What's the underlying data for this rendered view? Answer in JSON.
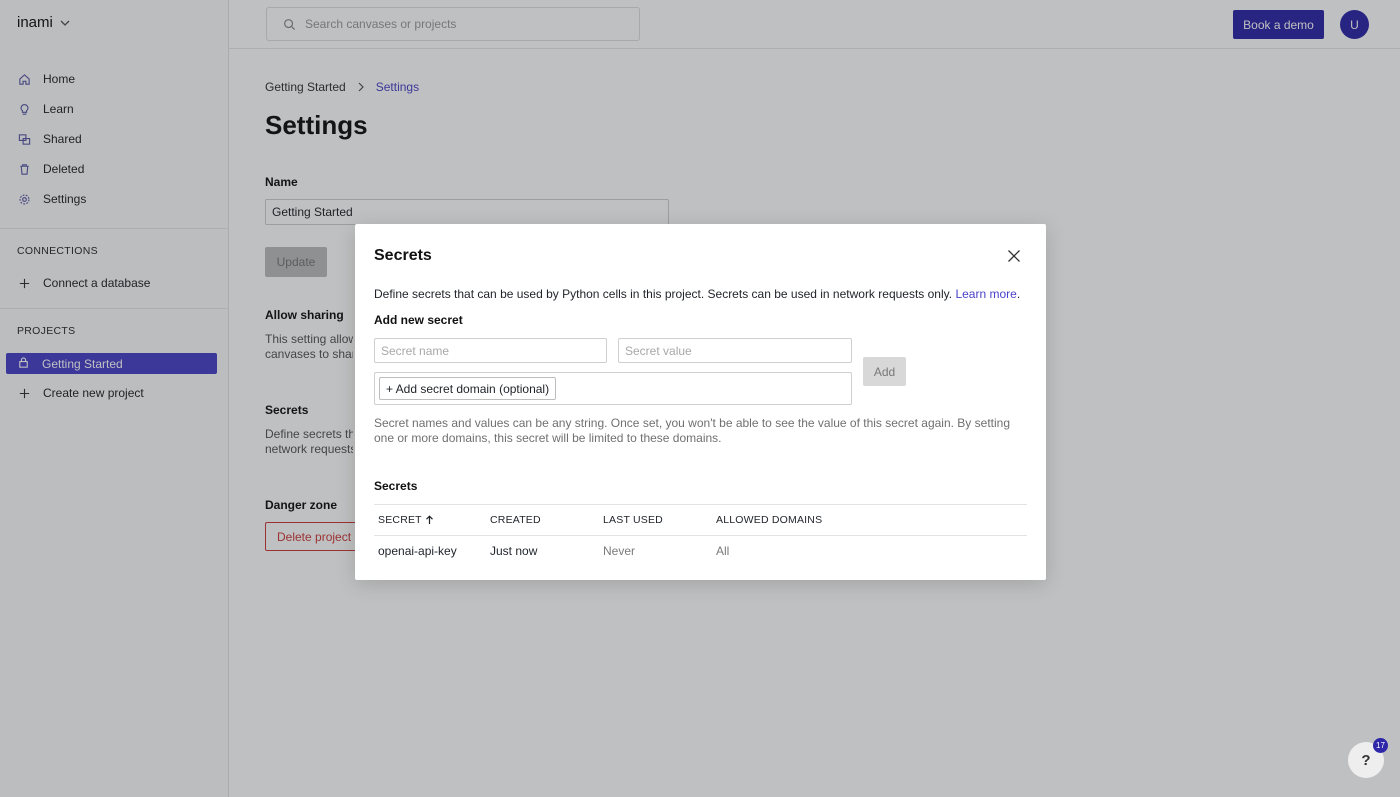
{
  "app": {
    "brand": "inami"
  },
  "sidebar": {
    "nav": [
      {
        "label": "Home",
        "icon": "home-icon"
      },
      {
        "label": "Learn",
        "icon": "lightbulb-icon"
      },
      {
        "label": "Shared",
        "icon": "shared-icon"
      },
      {
        "label": "Deleted",
        "icon": "trash-icon"
      },
      {
        "label": "Settings",
        "icon": "gear-icon"
      }
    ],
    "connections_label": "CONNECTIONS",
    "connect_db": "Connect a database",
    "projects_label": "PROJECTS",
    "active_project": "Getting Started",
    "create_project": "Create new project"
  },
  "topbar": {
    "search_placeholder": "Search canvases or projects",
    "demo_button": "Book a demo",
    "avatar_initial": "U"
  },
  "main": {
    "breadcrumb": {
      "parent": "Getting Started",
      "current": "Settings"
    },
    "title": "Settings",
    "name_label": "Name",
    "name_value": "Getting Started",
    "update_button": "Update",
    "allow_sharing_label": "Allow sharing",
    "allow_sharing_desc_1": "This setting allow",
    "allow_sharing_desc_2": "canvases to shar",
    "secrets_label": "Secrets",
    "secrets_desc_1": "Define secrets th",
    "secrets_desc_2": "network requests",
    "danger_label": "Danger zone",
    "delete_button": "Delete project"
  },
  "modal": {
    "title": "Secrets",
    "description": "Define secrets that can be used by Python cells in this project. Secrets can be used in network requests only.",
    "learn_more": "Learn more",
    "add_new_label": "Add new secret",
    "secret_name_placeholder": "Secret name",
    "secret_value_placeholder": "Secret value",
    "add_domain_chip": "+ Add secret domain (optional)",
    "add_button": "Add",
    "help_text": "Secret names and values can be any string. Once set, you won't be able to see the value of this secret again. By setting one or more domains, this secret will be limited to these domains.",
    "list_label": "Secrets",
    "columns": {
      "secret": "SECRET",
      "created": "CREATED",
      "last_used": "LAST USED",
      "allowed_domains": "ALLOWED DOMAINS"
    },
    "rows": [
      {
        "secret": "openai-api-key",
        "created": "Just now",
        "last_used": "Never",
        "allowed_domains": "All"
      }
    ]
  },
  "help": {
    "label": "?",
    "badge": "17"
  },
  "colors": {
    "accent": "#4a43c9",
    "brand_dark": "#2e27a8",
    "danger": "#cc3b3b"
  }
}
